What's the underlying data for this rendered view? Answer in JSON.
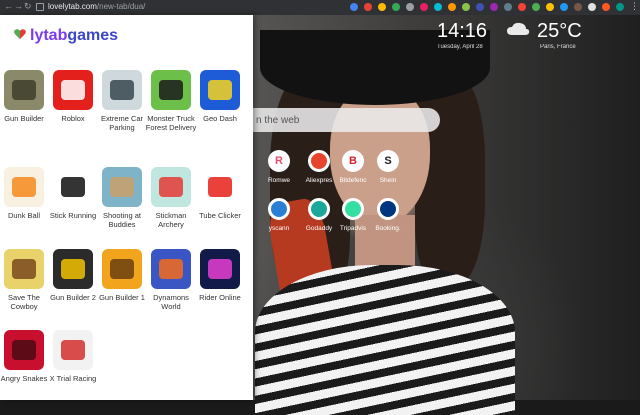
{
  "browser": {
    "url_host": "lovelytab.com",
    "url_path": "/new-tab/dua/"
  },
  "new_tab": {
    "time": "14:16",
    "date": "Tuesday, April 28",
    "temperature": "25°C",
    "location": "Paris, France",
    "search_placeholder": "n the web",
    "shortcuts_row1": [
      {
        "label": "Romwe",
        "glyph": "R",
        "color": "#e84a6e"
      },
      {
        "label": "Aliexpres",
        "glyph": "",
        "color": "#e8442d"
      },
      {
        "label": "Bitdefenc",
        "glyph": "B",
        "color": "#d4202c"
      },
      {
        "label": "Shein",
        "glyph": "S",
        "color": "#222222"
      }
    ],
    "shortcuts_row2": [
      {
        "label": "yscann",
        "glyph": "",
        "color": "#2a7fd4"
      },
      {
        "label": "Godaddy",
        "glyph": "",
        "color": "#1ba89a"
      },
      {
        "label": "Tripadvis",
        "glyph": "",
        "color": "#34e0a1"
      },
      {
        "label": "Booking.",
        "glyph": "",
        "color": "#003580"
      }
    ]
  },
  "panel": {
    "logo_part1": "lytab",
    "logo_part2": "games",
    "games": [
      {
        "name": "Gun Builder",
        "color": "#8a8a6a",
        "accent": "#3d3d2a"
      },
      {
        "name": "Roblox",
        "color": "#e3201b",
        "accent": "#ffffff"
      },
      {
        "name": "Extreme Car Parking",
        "color": "#cfd8dc",
        "accent": "#37474f"
      },
      {
        "name": "Monster Truck Forest Delivery",
        "color": "#6cc04a",
        "accent": "#1b1b1b"
      },
      {
        "name": "Geo Dash",
        "color": "#1e5bd6",
        "accent": "#f6d31e"
      },
      {
        "name": "Dunk Ball",
        "color": "#f8f0e0",
        "accent": "#f48a1d"
      },
      {
        "name": "Stick Running",
        "color": "#ffffff",
        "accent": "#111111"
      },
      {
        "name": "Shooting at Buddies",
        "color": "#7fb3c8",
        "accent": "#c9a06a"
      },
      {
        "name": "Stickman Archery",
        "color": "#bfe7e0",
        "accent": "#e53935"
      },
      {
        "name": "Tube Clicker",
        "color": "#ffffff",
        "accent": "#e62117"
      },
      {
        "name": "Save The Cowboy",
        "color": "#e9d26a",
        "accent": "#7a4a1d"
      },
      {
        "name": "Gun Builder 2",
        "color": "#2b2b2b",
        "accent": "#f2c200"
      },
      {
        "name": "Gun Builder 1",
        "color": "#f2a51c",
        "accent": "#6b3f10"
      },
      {
        "name": "Dynamons World",
        "color": "#3a55c4",
        "accent": "#f36b1c"
      },
      {
        "name": "Rider Online",
        "color": "#121a4a",
        "accent": "#e63fd3"
      },
      {
        "name": "Angry Snakes",
        "color": "#c8102e",
        "accent": "#4a0a12"
      },
      {
        "name": "X Trial Racing",
        "color": "#f2f2f2",
        "accent": "#d32f2f"
      }
    ]
  }
}
